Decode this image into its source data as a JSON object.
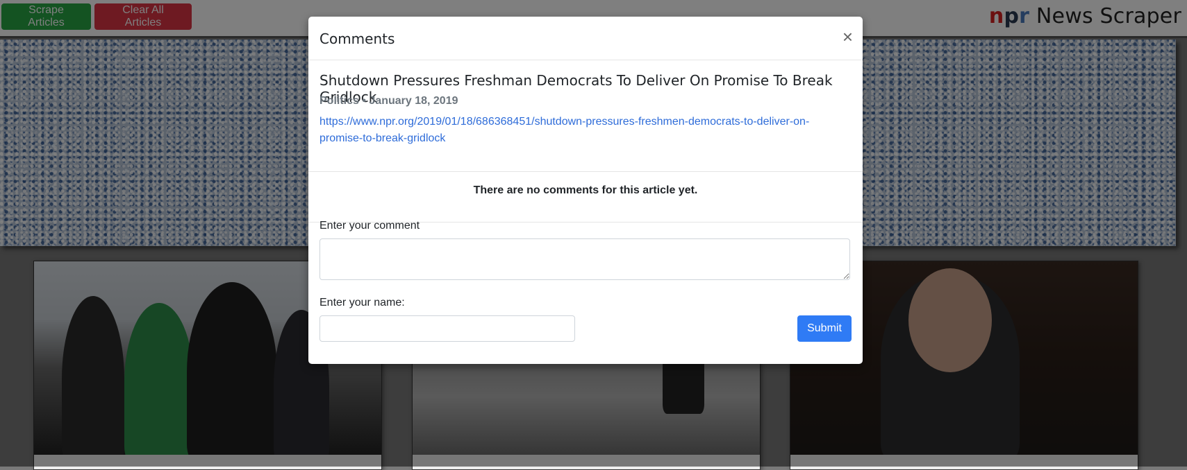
{
  "navbar": {
    "scrape_label": "Scrape Articles",
    "clear_label": "Clear All Articles",
    "brand_n": "n",
    "brand_p": "p",
    "brand_r": "r",
    "brand_rest": " News Scraper"
  },
  "colors": {
    "scrape": "#28a745",
    "clear": "#dc3545",
    "submit": "#2f7bf5",
    "link": "#2e6cd9",
    "brand_n": "#d62021",
    "brand_p": "#2a3b52",
    "brand_r": "#4b7bbf"
  },
  "modal": {
    "title": "Comments",
    "close_glyph": "×",
    "article": {
      "title": "Shutdown Pressures Freshman Democrats To Deliver On Promise To Break Gridlock",
      "meta": "Politics • January 18, 2019",
      "url": "https://www.npr.org/2019/01/18/686368451/shutdown-pressures-freshmen-democrats-to-deliver-on-promise-to-break-gridlock"
    },
    "no_comments_text": "There are no comments for this article yet.",
    "comment_label": "Enter your comment",
    "comment_value": "",
    "name_label": "Enter your name:",
    "name_value": "",
    "submit_label": "Submit"
  },
  "icons": {
    "close": "close-icon"
  }
}
